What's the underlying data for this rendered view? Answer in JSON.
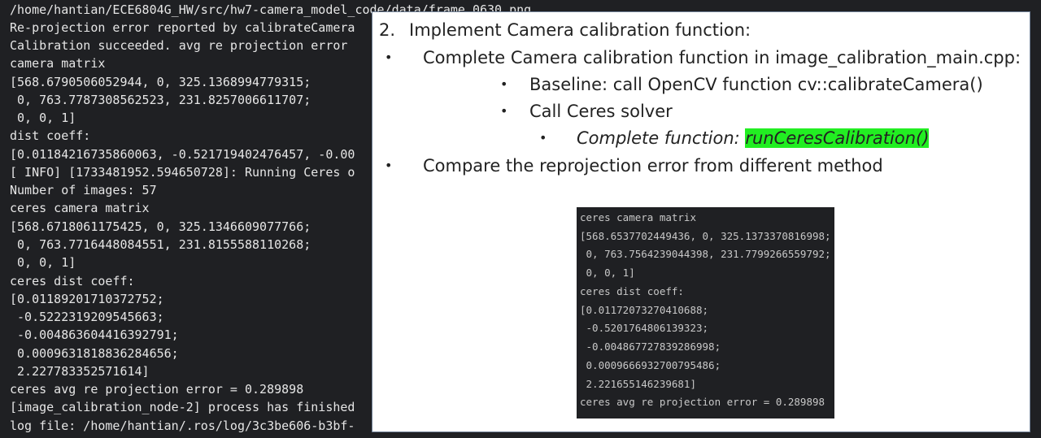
{
  "terminal": {
    "lines": [
      "/home/hantian/ECE6804G_HW/src/hw7-camera_model_code/data/frame_0630.png",
      "Re-projection error reported by calibrateCamera",
      "Calibration succeeded. avg re projection error",
      "camera matrix",
      "[568.6790506052944, 0, 325.1368994779315;",
      " 0, 763.7787308562523, 231.8257006611707;",
      " 0, 0, 1]",
      "dist coeff:",
      "[0.01184216735860063, -0.521719402476457, -0.00",
      "[ INFO] [1733481952.594650728]: Running Ceres o",
      "Number of images: 57",
      "ceres camera matrix",
      "[568.6718061175425, 0, 325.1346609077766;",
      " 0, 763.7716448084551, 231.8155588110268;",
      " 0, 0, 1]",
      "ceres dist coeff:",
      "[0.01189201710372752;",
      " -0.5222319209545663;",
      " -0.004863604416392791;",
      " 0.0009631818836284656;",
      " 2.227783352571614]",
      "ceres avg re projection error = 0.289898",
      "[image_calibration_node-2] process has finished",
      "log file: /home/hantian/.ros/log/3c3be606-b3bf-"
    ]
  },
  "slide": {
    "item_number": "2.",
    "heading": "Implement Camera calibration function:",
    "bullet_char": "•",
    "bullet1": "Complete Camera calibration function in image_calibration_main.cpp:",
    "sub1": "Baseline: call OpenCV function cv::calibrateCamera()",
    "sub2": "Call Ceres solver",
    "subsub1_prefix": "Complete function: ",
    "subsub1_highlight": "runCeresCalibration()",
    "bullet2": "Compare the reprojection error from different method"
  },
  "inset": {
    "lines": [
      "ceres camera matrix",
      "[568.6537702449436, 0, 325.1373370816998;",
      " 0, 763.7564239044398, 231.7799266559792;",
      " 0, 0, 1]",
      "ceres dist coeff:",
      "[0.01172073270410688;",
      " -0.5201764806139323;",
      " -0.004867727839286998;",
      " 0.0009666932700795486;",
      " 2.221655146239681]",
      "ceres avg re projection error = 0.289898"
    ]
  },
  "colors": {
    "terminal_bg": "#1f2023",
    "terminal_text": "#e6e6e6",
    "slide_bg": "#ffffff",
    "highlight": "#22ee22"
  }
}
